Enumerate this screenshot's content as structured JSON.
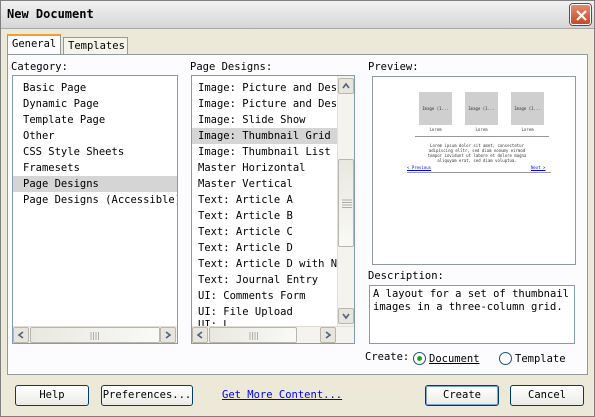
{
  "window": {
    "title": "New Document"
  },
  "tabs": [
    {
      "label": "General"
    },
    {
      "label": "Templates"
    }
  ],
  "category": {
    "label": "Category:",
    "items": [
      "Basic Page",
      "Dynamic Page",
      "Template Page",
      "Other",
      "CSS Style Sheets",
      "Framesets",
      "Page Designs",
      "Page Designs (Accessible)"
    ],
    "selected": "Page Designs"
  },
  "page_designs": {
    "label": "Page Designs:",
    "items": [
      "Image: Picture and Desc",
      "Image: Picture and Desc",
      "Image: Slide Show",
      "Image: Thumbnail Grid",
      "Image: Thumbnail List",
      "Master Horizontal",
      "Master Vertical",
      "Text: Article A",
      "Text: Article B",
      "Text: Article C",
      "Text: Article D",
      "Text: Article D with Na",
      "Text: Journal Entry",
      "UI: Comments Form",
      "UI: File Upload",
      "UI: L"
    ],
    "selected": "Image: Thumbnail Grid"
  },
  "preview": {
    "label": "Preview:",
    "thumb_label": "Image (1...",
    "caption": "Lorem",
    "body_text": "Lorem ipsum dolor sit amet, consectetur adipiscing elitr, sed diam nonumy eirmod tempor invidunt ut labore et dolore magna aliquyam erat, sed diam voluptua.",
    "prev_link": "< Previous",
    "next_link": "Next >"
  },
  "description": {
    "label": "Description:",
    "text": "A layout for a set of thumbnail images in a three-column grid."
  },
  "create": {
    "label": "Create:",
    "options": [
      "Document",
      "Template"
    ],
    "selected": "Document"
  },
  "buttons": {
    "help": "Help",
    "preferences": "Preferences...",
    "get_more": "Get More Content...",
    "create": "Create",
    "cancel": "Cancel"
  },
  "colors": {
    "selection": "#d5d5d5",
    "link": "#0000ee",
    "close": "#c44a2a",
    "radio_dot": "#21a121"
  }
}
